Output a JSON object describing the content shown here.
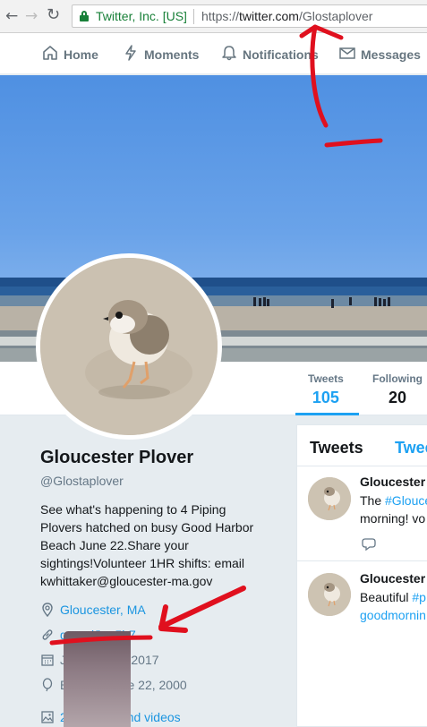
{
  "browser": {
    "back_icon": "back-arrow-icon",
    "forward_icon": "forward-arrow-icon",
    "reload_icon": "reload-icon",
    "security_label": "Twitter, Inc. [US]",
    "url_scheme": "https://",
    "url_host": "twitter.com",
    "url_path": "/Glostaplover"
  },
  "topnav": {
    "items": [
      {
        "label": "Home",
        "icon": "home-icon"
      },
      {
        "label": "Moments",
        "icon": "lightning-icon"
      },
      {
        "label": "Notifications",
        "icon": "bell-icon"
      },
      {
        "label": "Messages",
        "icon": "envelope-icon"
      }
    ]
  },
  "profile": {
    "name": "Gloucester Plover",
    "handle": "@Glostaplover",
    "bio": [
      "See what's happening to 4 Piping",
      "Plovers hatched on busy Good Harbor",
      "Beach June 22.Share your",
      "sightings!Volunteer 1HR shifts: email",
      "kwhittaker@gloucester-ma.gov"
    ],
    "location": "Gloucester, MA",
    "website": "goo.gl/imr5h7",
    "joined": "Joined June 2017",
    "born": "Born on June 22, 2000",
    "media": "28 Photos and videos"
  },
  "stats": [
    {
      "label": "Tweets",
      "value": "105"
    },
    {
      "label": "Following",
      "value": "20"
    }
  ],
  "timeline": {
    "title": "Tweets",
    "tab2": "Twee",
    "tweets": [
      {
        "author": "Gloucester",
        "line1_prefix": "The ",
        "line1_hash": "#Glouce",
        "line2": "morning! vo"
      },
      {
        "author": "Gloucester",
        "line1_prefix": "Beautiful ",
        "line1_hash": "#p",
        "line2_hash": "goodmornin"
      }
    ]
  },
  "colors": {
    "twitter_blue": "#1da1f2",
    "link_blue": "#1b95e0",
    "secure_green": "#188038",
    "annotation_red": "#e0101e"
  }
}
